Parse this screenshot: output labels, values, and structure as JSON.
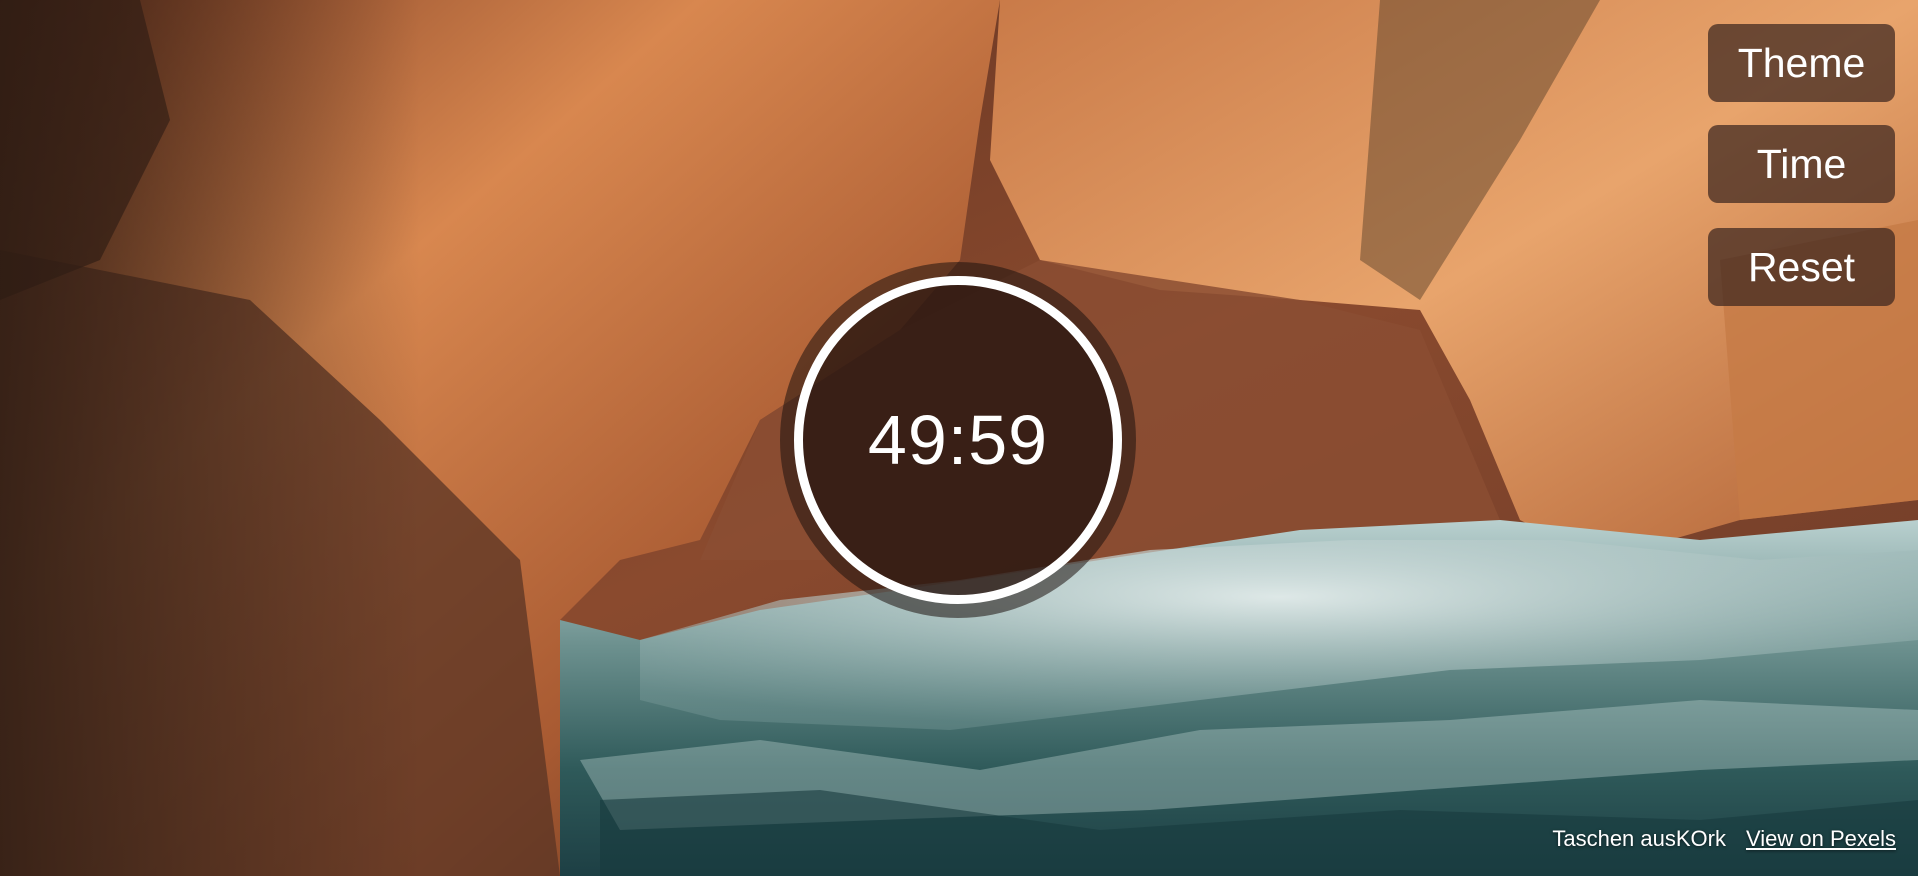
{
  "timer": {
    "display": "49:59"
  },
  "controls": {
    "theme_label": "Theme",
    "time_label": "Time",
    "reset_label": "Reset"
  },
  "credit": {
    "author": "Taschen ausKOrk",
    "link_label": "View on Pexels"
  },
  "colors": {
    "button_bg": "#3c261e",
    "timer_ring": "#ffffff",
    "text": "#ffffff"
  },
  "background": {
    "subject": "aerial photo of orange sea cliffs, sandy cove and foamy ocean waves"
  }
}
